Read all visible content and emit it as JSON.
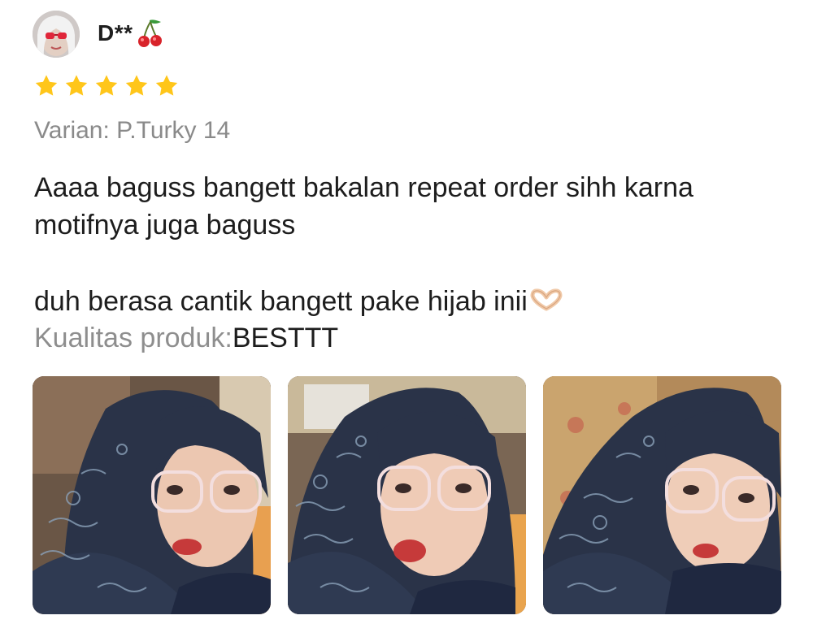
{
  "review": {
    "user": {
      "name": "D**",
      "avatar_icon": "avatar-photo",
      "badge_icon": "cherry-icon"
    },
    "rating": {
      "value": 5,
      "max": 5,
      "color": "#FFC61A"
    },
    "variant_text": "Varian: P.Turky 14",
    "comment": {
      "line1": "Aaaa baguss bangett bakalan repeat order sihh karna motifnya juga baguss",
      "line2": "duh berasa cantik bangett pake hijab inii",
      "trailing_emoji": "heart-hands-icon"
    },
    "quality": {
      "label": "Kualitas produk:",
      "value": "BESTTT"
    },
    "photos": [
      {
        "icon": "review-photo-1"
      },
      {
        "icon": "review-photo-2"
      },
      {
        "icon": "review-photo-3"
      }
    ]
  }
}
